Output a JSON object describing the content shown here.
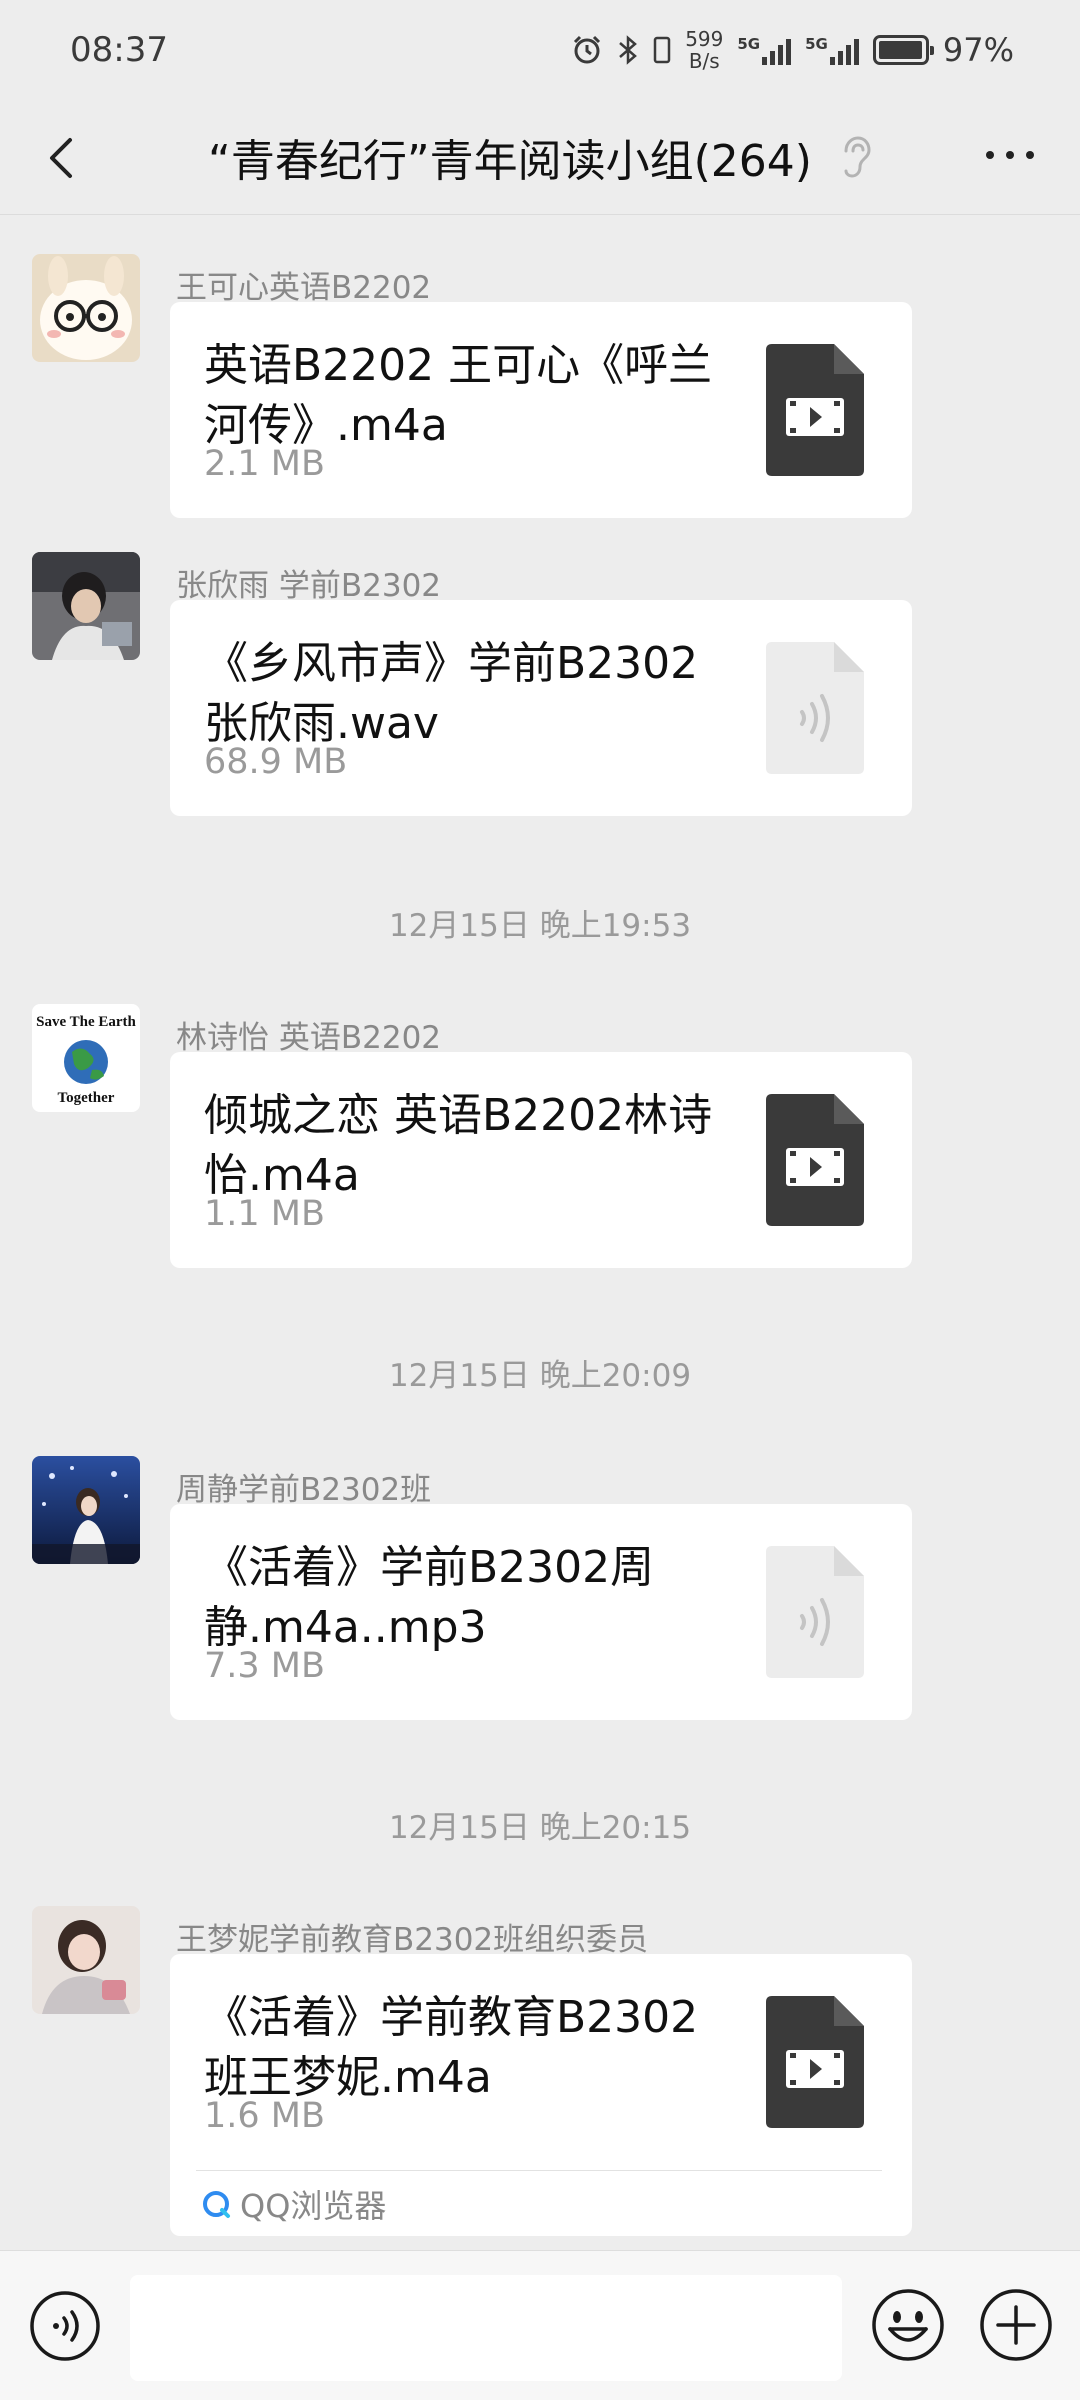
{
  "status_bar": {
    "time": "08:37",
    "net_speed_value": "599",
    "net_speed_unit": "B/s",
    "sig1_label": "5G",
    "sig2_label": "5G",
    "battery_percent_text": "97%",
    "battery_level": 0.97,
    "icons": [
      "alarm-icon",
      "bluetooth-icon",
      "signal-icon",
      "battery-icon"
    ]
  },
  "header": {
    "title": "“青春纪行”青年阅读小组(264)",
    "icons": [
      "back-icon",
      "ear-icon",
      "more-icon"
    ]
  },
  "messages": [
    {
      "sender": "王可心英语B2202",
      "file_name": "英语B2202 王可心《呼兰河传》.m4a",
      "file_size": "2.1 MB",
      "file_icon": "video-file-icon"
    },
    {
      "sender": "张欣雨 学前B2302",
      "file_name": "《乡风市声》学前B2302张欣雨.wav",
      "file_size": "68.9 MB",
      "file_icon": "audio-file-icon"
    },
    {
      "sender": "林诗怡 英语B2202",
      "file_name": "倾城之恋 英语B2202林诗怡.m4a",
      "file_size": "1.1 MB",
      "file_icon": "video-file-icon",
      "avatar_text_top": "Save The Earth",
      "avatar_text_bottom": "Together"
    },
    {
      "sender": "周静学前B2302班",
      "file_name": "《活着》学前B2302周静.m4a..mp3",
      "file_size": "7.3 MB",
      "file_icon": "audio-file-icon"
    },
    {
      "sender": "王梦妮学前教育B2302班组织委员",
      "file_name": "《活着》学前教育B2302班王梦妮.m4a",
      "file_size": "1.6 MB",
      "file_icon": "video-file-icon",
      "source_app": "QQ浏览器"
    }
  ],
  "timestamps": [
    "12月15日 晚上19:53",
    "12月15日 晚上20:09",
    "12月15日 晚上20:15"
  ],
  "input_bar": {
    "text_value": "",
    "icons": [
      "voice-icon",
      "emoji-icon",
      "plus-icon"
    ]
  }
}
